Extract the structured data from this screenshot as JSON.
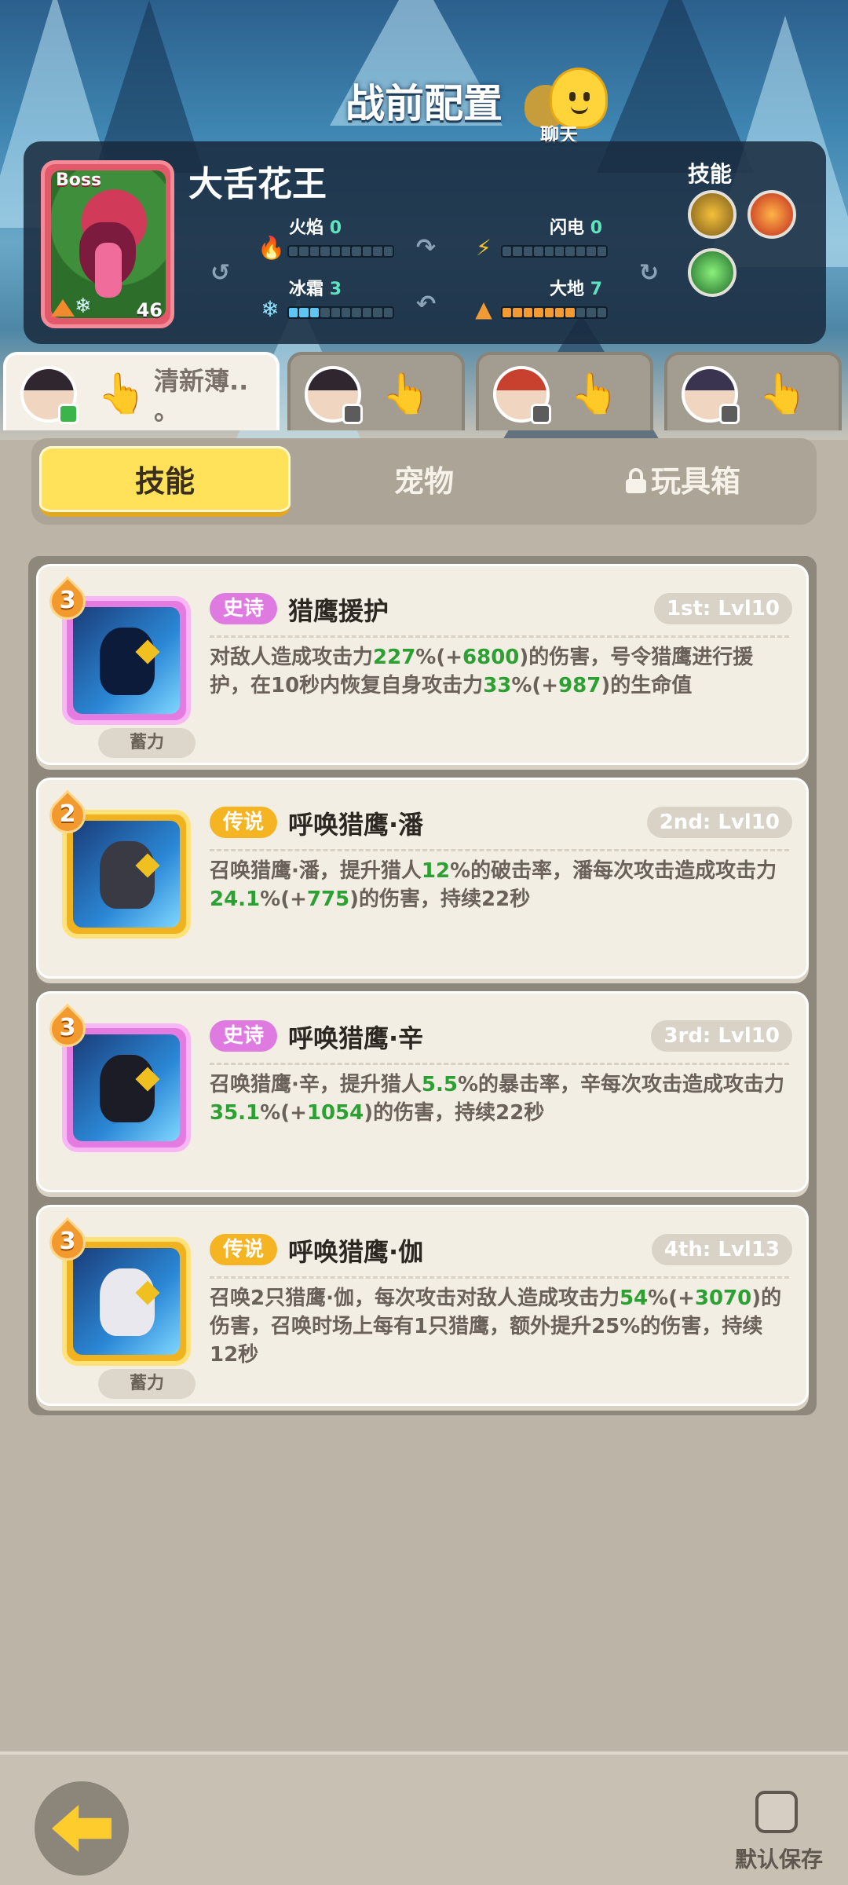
{
  "header": {
    "title": "战前配置",
    "chat_label": "聊天"
  },
  "boss": {
    "tag": "Boss",
    "name": "大舌花王",
    "level": "46",
    "stats": [
      {
        "label": "火焰",
        "value": "0",
        "filled": 0,
        "color": "#e04a3a",
        "icon": "fire-icon"
      },
      {
        "label": "闪电",
        "value": "0",
        "filled": 0,
        "color": "#f3c12f",
        "icon": "lightning-icon"
      },
      {
        "label": "冰霜",
        "value": "3",
        "filled": 3,
        "color": "#5ec6f0",
        "icon": "snowflake-icon"
      },
      {
        "label": "大地",
        "value": "7",
        "filled": 7,
        "color": "#f29a34",
        "icon": "earth-icon"
      }
    ],
    "skills_label": "技能"
  },
  "heroes": [
    {
      "name": "清新薄..\n。",
      "active": true
    },
    {
      "name": "",
      "active": false
    },
    {
      "name": "",
      "active": false
    },
    {
      "name": "",
      "active": false
    }
  ],
  "tabs": {
    "skills": "技能",
    "pets": "宠物",
    "toybox": "玩具箱"
  },
  "skill_cards": [
    {
      "stars": "3",
      "rarity": "史诗",
      "rarity_type": "epic",
      "name": "猎鹰援护",
      "slot": "1st: Lvl10",
      "charge": "蓄力",
      "desc_parts": [
        [
          "对敌人造成攻击力",
          false
        ],
        [
          "227",
          true
        ],
        [
          "%(+",
          false
        ],
        [
          "6800",
          true
        ],
        [
          ")的伤害，号令猎鹰进行援护，在10秒内恢复自身攻击力",
          false
        ],
        [
          "33",
          true
        ],
        [
          "%(+",
          false
        ],
        [
          "987",
          true
        ],
        [
          ")的生命值",
          false
        ]
      ]
    },
    {
      "stars": "2",
      "rarity": "传说",
      "rarity_type": "legend",
      "name": "呼唤猎鹰·潘",
      "slot": "2nd: Lvl10",
      "charge": "",
      "desc_parts": [
        [
          "召唤猎鹰·潘，提升猎人",
          false
        ],
        [
          "12",
          true
        ],
        [
          "%的破击率，潘每次攻击造成攻击力",
          false
        ],
        [
          "24.1",
          true
        ],
        [
          "%(+",
          false
        ],
        [
          "775",
          true
        ],
        [
          ")的伤害，持续22秒",
          false
        ]
      ]
    },
    {
      "stars": "3",
      "rarity": "史诗",
      "rarity_type": "epic",
      "name": "呼唤猎鹰·辛",
      "slot": "3rd: Lvl10",
      "charge": "",
      "desc_parts": [
        [
          "召唤猎鹰·辛，提升猎人",
          false
        ],
        [
          "5.5",
          true
        ],
        [
          "%的暴击率，辛每次攻击造成攻击力",
          false
        ],
        [
          "35.1",
          true
        ],
        [
          "%(+",
          false
        ],
        [
          "1054",
          true
        ],
        [
          ")的伤害，持续22秒",
          false
        ]
      ]
    },
    {
      "stars": "3",
      "rarity": "传说",
      "rarity_type": "legend",
      "name": "呼唤猎鹰·伽",
      "slot": "4th: Lvl13",
      "charge": "蓄力",
      "desc_parts": [
        [
          "召唤2只猎鹰·伽，每次攻击对敌人造成攻击力",
          false
        ],
        [
          "54",
          true
        ],
        [
          "%(+",
          false
        ],
        [
          "3070",
          true
        ],
        [
          ")的伤害，召唤时场上每有1只猎鹰，额外提升25%的伤害，持续12秒",
          false
        ]
      ]
    }
  ],
  "footer": {
    "save_label": "默认保存"
  }
}
